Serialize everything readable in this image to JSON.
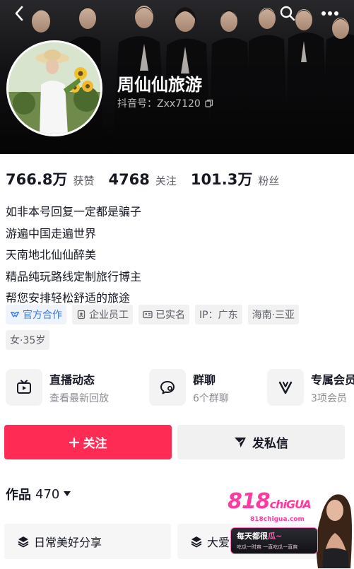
{
  "header": {
    "name": "周仙仙旅游",
    "douyin_id": "抖音号：Zxx7120",
    "icons": {
      "back": "back-arrow-icon",
      "search": "search-icon",
      "more": "more-dots-icon",
      "copy": "copy-icon"
    }
  },
  "stats": [
    {
      "value": "766.8万",
      "label": "获赞"
    },
    {
      "value": "4768",
      "label": "关注"
    },
    {
      "value": "101.3万",
      "label": "粉丝"
    }
  ],
  "bio": [
    "如非本号回复一定都是骗子",
    "游遍中国走遍世界",
    "天南地北仙仙醉美",
    "精品纯玩路线定制旅行博主",
    "帮您安排轻松舒适的旅途"
  ],
  "tags": {
    "official": "官方合作",
    "employee": "企业员工",
    "verified": "已实名",
    "ip": "IP：广东",
    "location": "海南·三亚",
    "gender_age": "女·35岁"
  },
  "features": [
    {
      "title": "直播动态",
      "subtitle": "查看最新回放",
      "icon": "tv-icon"
    },
    {
      "title": "群聊",
      "subtitle": "6个群聊",
      "icon": "chat-bubble-icon"
    },
    {
      "title": "专属会员",
      "subtitle": "3项会员",
      "icon": "v-badge-icon"
    }
  ],
  "actions": {
    "follow": "关注",
    "message": "发私信"
  },
  "works": {
    "label": "作品",
    "count": "470"
  },
  "collections": [
    {
      "label": "日常美好分享",
      "icon": "layers-icon"
    },
    {
      "label": "大爱无疆",
      "icon": "layers-icon"
    }
  ],
  "promo": {
    "logo": "818",
    "logo_tail": "chiGUA",
    "site": "818chigua.com",
    "slogan_a": "每天都很",
    "slogan_b": "瓜~",
    "sub": "吃瓜一时爽 一直吃瓜一直爽"
  },
  "colors": {
    "accent": "#fe2c55",
    "official": "#3b7ee0",
    "text": "#161823",
    "muted": "#5c5f66"
  }
}
